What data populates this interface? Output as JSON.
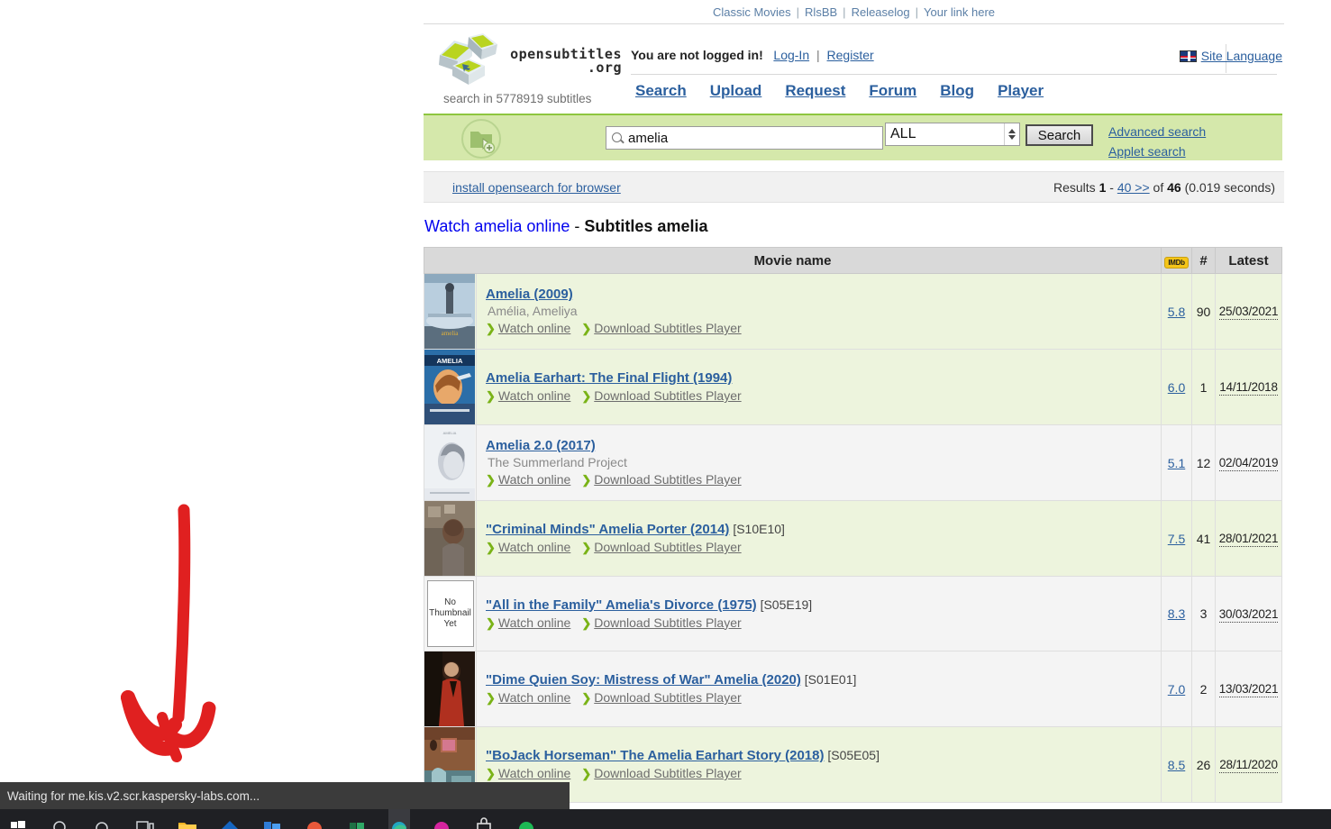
{
  "topbar": {
    "links": [
      "Classic Movies",
      "RlsBB",
      "Releaselog",
      "Your link here"
    ],
    "separator": "|"
  },
  "header": {
    "logo_text": "opensubtitles",
    "logo_tld": ".org",
    "subtitle_count": "search in 5778919 subtitles",
    "login_message": "You are not logged in!",
    "login_label": "Log-In",
    "register_label": "Register",
    "pipe": "|",
    "site_language_label": "Site Language",
    "nav": [
      "Search",
      "Upload",
      "Request",
      "Forum",
      "Blog",
      "Player"
    ]
  },
  "search": {
    "query_value": "amelia",
    "category_value": "ALL",
    "button_label": "Search",
    "advanced_label": "Advanced search",
    "applet_label": "Applet search"
  },
  "resultsbar": {
    "opensearch_label": "install opensearch for browser",
    "prefix": "Results",
    "from": "1",
    "dash": "-",
    "page_link": "40 >>",
    "of": "of",
    "total": "46",
    "time": "(0.019 seconds)"
  },
  "pagehead": {
    "link": "Watch amelia online",
    "dash": " - ",
    "bold": "Subtitles amelia"
  },
  "table": {
    "columns": {
      "movie_name": "Movie name",
      "imdb": "IMDb",
      "count": "#",
      "latest": "Latest"
    },
    "no_thumbnail_text": "No Thumbnail Yet",
    "watch_label": "Watch online",
    "download_label": "Download Subtitles Player",
    "rows": [
      {
        "title": "Amelia (2009)",
        "episode": "",
        "alt": "Amélia, Ameliya",
        "rating": "5.8",
        "count": "90",
        "latest": "25/03/2021",
        "thumb": "amelia-poster",
        "shade": "odd"
      },
      {
        "title": "Amelia Earhart: The Final Flight (1994)",
        "episode": "",
        "alt": "",
        "rating": "6.0",
        "count": "1",
        "latest": "14/11/2018",
        "thumb": "earhart-poster",
        "shade": "odd"
      },
      {
        "title": "Amelia 2.0 (2017)",
        "episode": "",
        "alt": "The Summerland Project",
        "rating": "5.1",
        "count": "12",
        "latest": "02/04/2019",
        "thumb": "amelia20-poster",
        "shade": "even"
      },
      {
        "title": "\"Criminal Minds\" Amelia Porter (2014)",
        "episode": "[S10E10]",
        "alt": "",
        "rating": "7.5",
        "count": "41",
        "latest": "28/01/2021",
        "thumb": "criminalminds-still",
        "shade": "odd"
      },
      {
        "title": "\"All in the Family\" Amelia's Divorce (1975)",
        "episode": "[S05E19]",
        "alt": "",
        "rating": "8.3",
        "count": "3",
        "latest": "30/03/2021",
        "thumb": "no-thumbnail",
        "shade": "even"
      },
      {
        "title": "\"Dime Quien Soy: Mistress of War\" Amelia (2020)",
        "episode": "[S01E01]",
        "alt": "",
        "rating": "7.0",
        "count": "2",
        "latest": "13/03/2021",
        "thumb": "dimequiensoy-still",
        "shade": "even"
      },
      {
        "title": "\"BoJack Horseman\" The Amelia Earhart Story (2018)",
        "episode": "[S05E05]",
        "alt": "",
        "rating": "8.5",
        "count": "26",
        "latest": "28/11/2020",
        "thumb": "bojack-still",
        "shade": "odd"
      }
    ]
  },
  "status": {
    "text": "Waiting for me.kis.v2.scr.kaspersky-labs.com..."
  },
  "annotation": {
    "arrow_color": "#e02020"
  },
  "colors": {
    "link": "#2b5f9e",
    "band_green": "#d5e8ab",
    "row_green": "#edf4dd",
    "row_gray": "#f4f4f4",
    "header_gray": "#d9d9d9",
    "imdb_yellow": "#f5c518",
    "taskbar": "#1f2024"
  }
}
